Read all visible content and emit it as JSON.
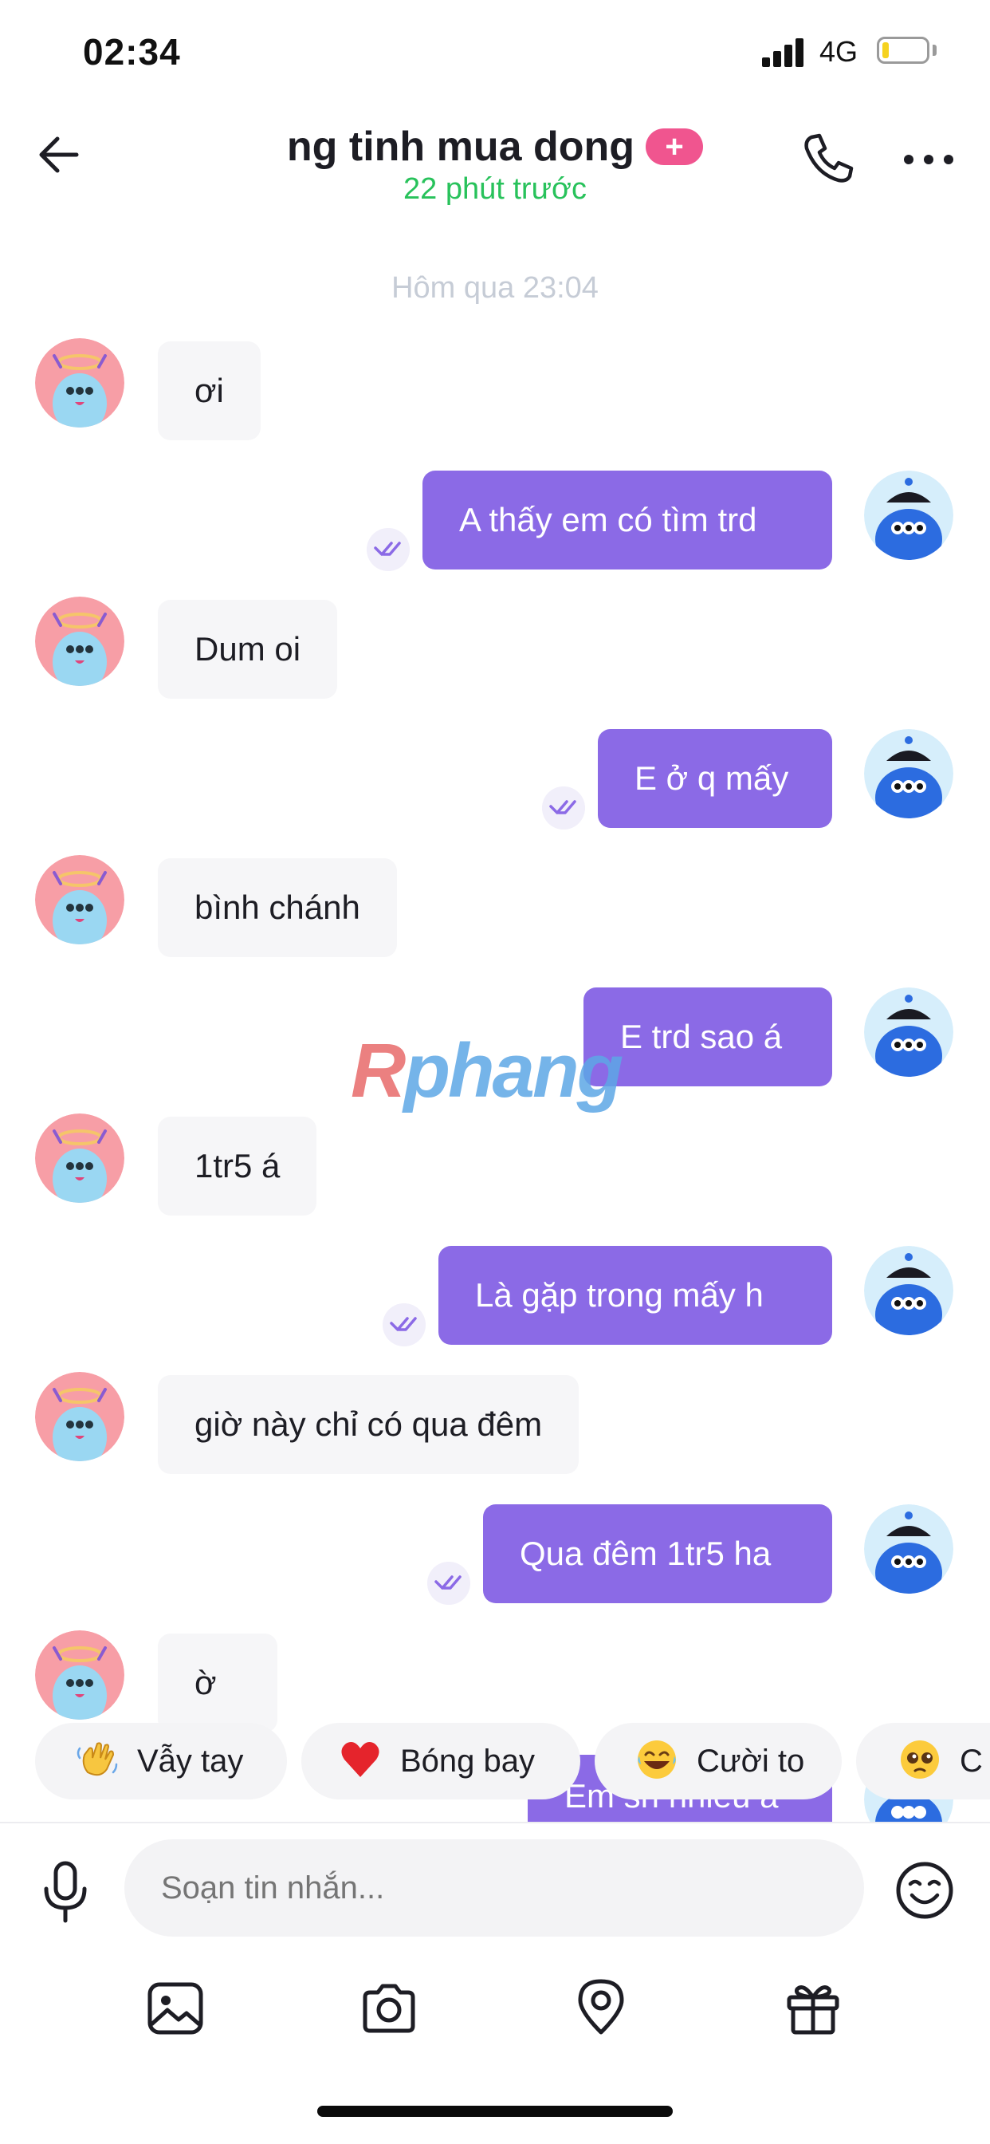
{
  "status_bar": {
    "time": "02:34",
    "network": "4G"
  },
  "header": {
    "title": "ng tinh mua dong",
    "badge": "+",
    "subtitle": "22 phút trước"
  },
  "date_separator": "Hôm qua 23:04",
  "messages": [
    {
      "direction": "in",
      "text": "ơi"
    },
    {
      "direction": "out",
      "text": "A thấy em có tìm trd"
    },
    {
      "direction": "in",
      "text": "Dum oi"
    },
    {
      "direction": "out",
      "text": "E ở q mấy"
    },
    {
      "direction": "in",
      "text": "bình chánh"
    },
    {
      "direction": "out",
      "text": "E trd sao á"
    },
    {
      "direction": "in",
      "text": "1tr5 á"
    },
    {
      "direction": "out",
      "text": "Là gặp trong mấy h"
    },
    {
      "direction": "in",
      "text": "giờ này chỉ có qua đêm"
    },
    {
      "direction": "out",
      "text": "Qua đêm 1tr5 ha"
    },
    {
      "direction": "in",
      "text": "ờ"
    },
    {
      "direction": "out",
      "text": "Em sn nhiêu a"
    }
  ],
  "watermark": {
    "accent": "R",
    "rest": "phang"
  },
  "quick_reactions": [
    {
      "icon": "waving-hand-icon",
      "label": "Vẫy tay"
    },
    {
      "icon": "heart-icon",
      "label": "Bóng bay"
    },
    {
      "icon": "laughing-face-icon",
      "label": "Cười to"
    },
    {
      "icon": "pleading-face-icon",
      "label": "C"
    }
  ],
  "composer": {
    "placeholder": "Soạn tin nhắn..."
  },
  "colors": {
    "accent": "#8b6ae6",
    "online": "#28c25b",
    "badge": "#f0558f",
    "incoming_bg": "#f6f6f8"
  }
}
